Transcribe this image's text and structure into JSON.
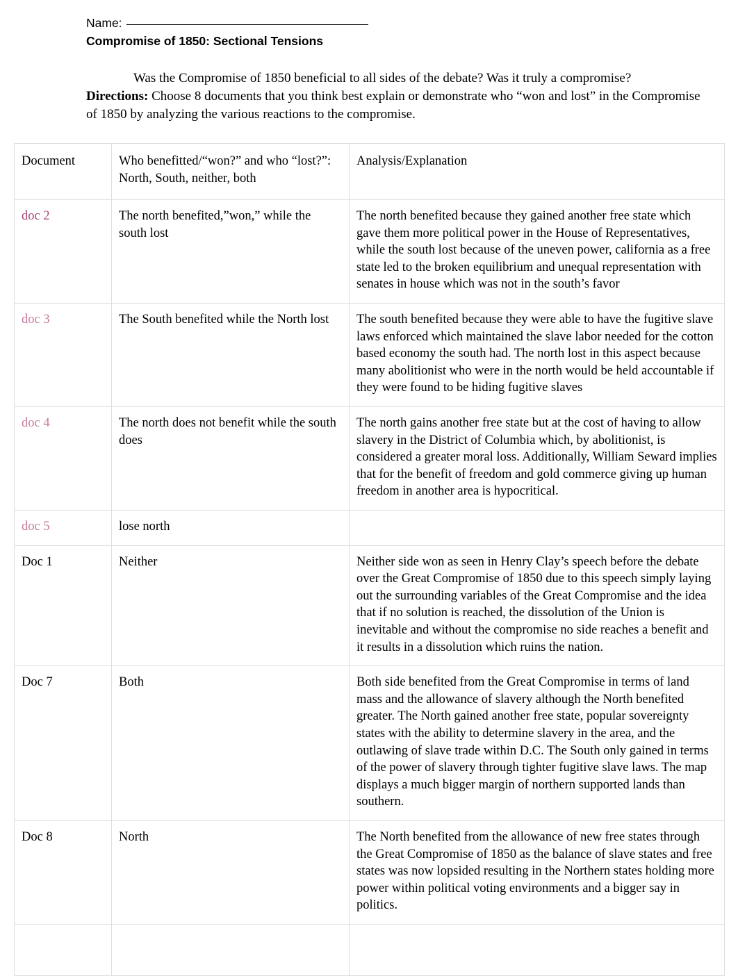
{
  "header": {
    "name_label": "Name:",
    "title": "Compromise of 1850: Sectional Tensions"
  },
  "intro": {
    "prompt": "Was the Compromise of 1850 beneficial to all sides of the debate? Was it truly a compromise?",
    "directions_label": "Directions:",
    "directions_text": " Choose 8 documents that you think best explain or demonstrate who “won and lost” in the Compromise of 1850 by analyzing the various reactions to the compromise."
  },
  "table": {
    "columns": [
      "Document",
      "Who benefitted/“won?” and who “lost?”: North, South, neither, both",
      "Analysis/Explanation"
    ],
    "rows": [
      {
        "document": "doc 2",
        "doc_color": "#a8457a",
        "who": "The north benefited,”won,” while the south lost",
        "analysis": "The north benefited because they gained another free state which gave them more political power in the House of Representatives, while the south lost because of the uneven power, california as a free state led to the broken equilibrium and unequal representation with senates in house which was not in the south’s favor"
      },
      {
        "document": "doc 3",
        "doc_color": "#c77a9f",
        "who": "The South benefited while the North lost",
        "analysis": "The south benefited because they were able to have the fugitive slave laws enforced which maintained the slave labor needed for the cotton based  economy the south had. The north lost in this aspect because many abolitionist who were in the north would be held accountable if they were found to be hiding fugitive slaves"
      },
      {
        "document": "doc 4",
        "doc_color": "#c77a9f",
        "who": "The north does not benefit while the south does",
        "analysis": "The north gains another free state but at the cost of having to allow slavery in the District of Columbia which, by abolitionist, is considered a greater moral loss. Additionally, William Seward implies that for the benefit of freedom and gold commerce giving up human freedom in another area is hypocritical."
      },
      {
        "document": "doc 5",
        "doc_color": "#c77a9f",
        "who": "lose north",
        "analysis": ""
      },
      {
        "document": "Doc 1",
        "doc_color": "#000000",
        "who": "Neither",
        "analysis": "Neither side won as seen in Henry Clay’s speech before the debate over the Great Compromise of 1850 due to this speech simply laying out the surrounding variables of the Great Compromise and the idea that if no solution is reached, the dissolution of the Union is inevitable and without the compromise no side reaches a benefit and it results in a dissolution which ruins the nation."
      },
      {
        "document": "Doc 7",
        "doc_color": "#000000",
        "who": "Both",
        "analysis": "Both side benefited from the Great Compromise in terms of land mass and the allowance of slavery although the North benefited greater. The North gained another free state, popular sovereignty states with the ability to determine slavery in the area, and the outlawing of slave trade within D.C. The South only gained in terms of the power of slavery through tighter fugitive slave laws. The map displays a much bigger margin of northern supported lands than southern."
      },
      {
        "document": "Doc 8",
        "doc_color": "#000000",
        "who": "North",
        "analysis": "The North benefited from the allowance of new free states through the Great Compromise of 1850 as the balance of slave states and free states was now lopsided resulting in the Northern states holding more power within political voting environments and a bigger say in politics."
      },
      {
        "document": "",
        "doc_color": "#000000",
        "who": "",
        "analysis": ""
      }
    ]
  },
  "theme": {
    "border_color": "#dedede",
    "text_color": "#000000",
    "accent_pink": "#a8457a",
    "accent_pink_light": "#c77a9f",
    "page_background": "#ffffff"
  }
}
